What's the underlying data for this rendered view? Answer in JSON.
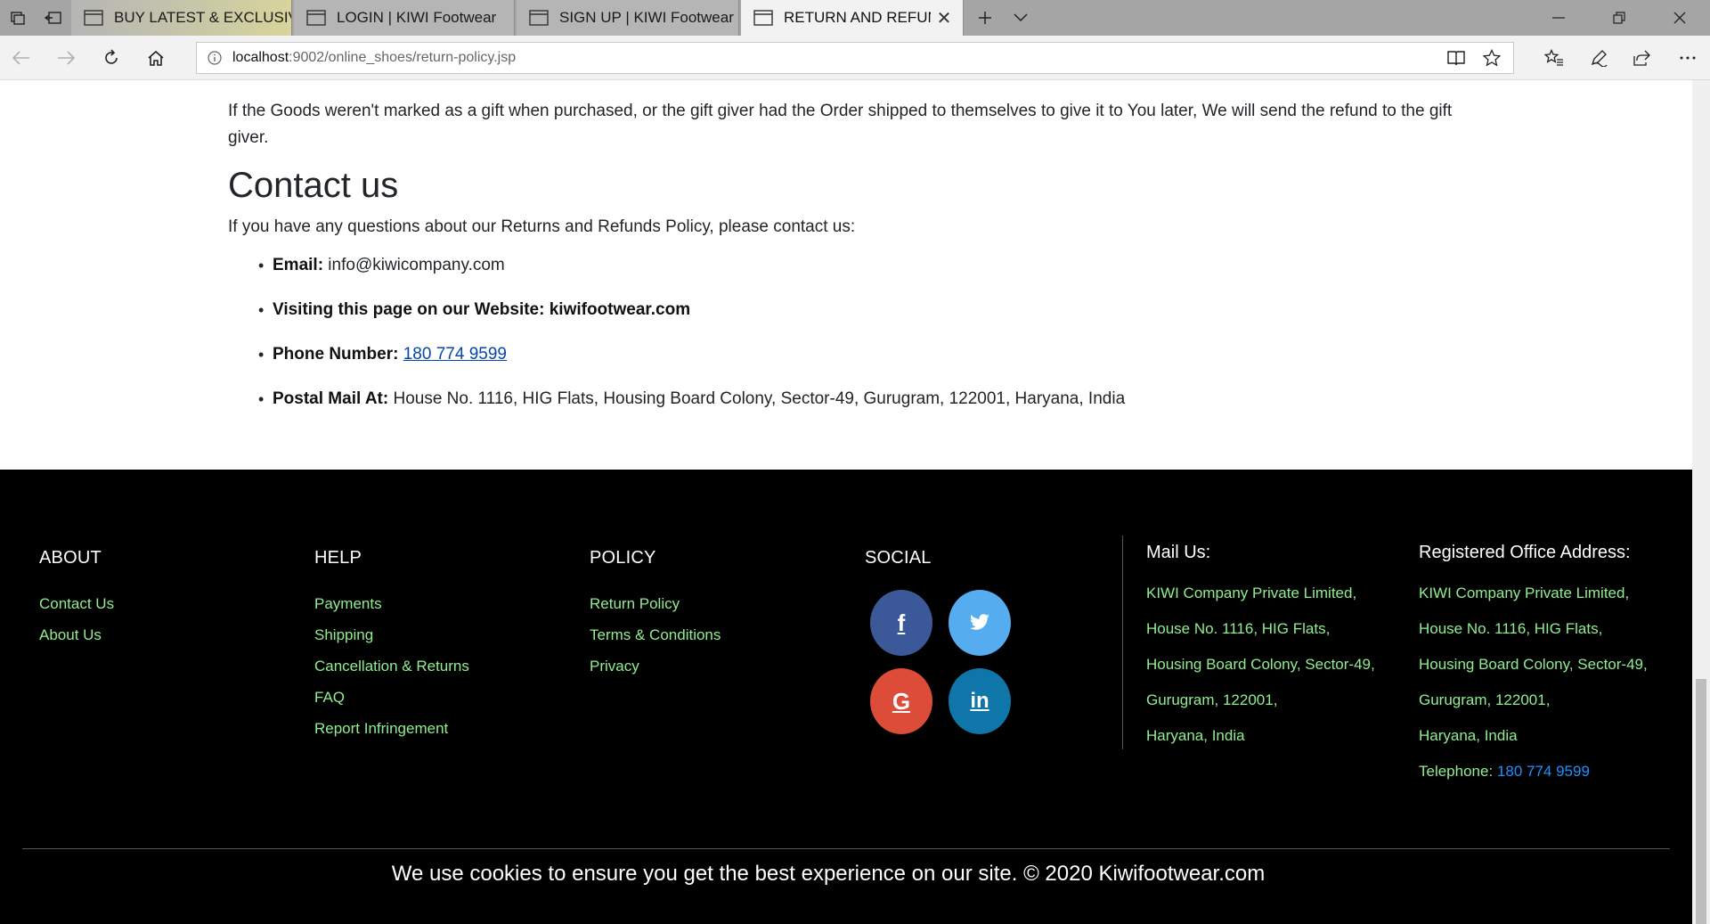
{
  "browser": {
    "tabs": [
      {
        "title": "BUY LATEST & EXCLUSIVE F",
        "active": false
      },
      {
        "title": "LOGIN | KIWI Footwear",
        "active": false
      },
      {
        "title": "SIGN UP | KIWI Footwear",
        "active": false
      },
      {
        "title": "RETURN AND REFUND",
        "active": true
      }
    ],
    "url_host": "localhost",
    "url_rest": ":9002/online_shoes/return-policy.jsp"
  },
  "content": {
    "gift_paragraph": "If the Goods weren't marked as a gift when purchased, or the gift giver had the Order shipped to themselves to give it to You later, We will send the refund to the gift giver.",
    "contact_heading": "Contact us",
    "contact_intro": "If you have any questions about our Returns and Refunds Policy, please contact us:",
    "email_label": "Email:",
    "email_value": " info@kiwicompany.com",
    "website_label": "Visiting this page on our Website: kiwifootwear.com",
    "phone_label": "Phone Number:",
    "phone_value": "180 774 9599",
    "postal_label": "Postal Mail At:",
    "postal_value": " House No. 1116, HIG Flats, Housing Board Colony, Sector-49, Gurugram, 122001, Haryana, India"
  },
  "footer": {
    "about": {
      "title": "ABOUT",
      "links": [
        "Contact Us",
        "About Us"
      ]
    },
    "help": {
      "title": "HELP",
      "links": [
        "Payments",
        "Shipping",
        "Cancellation & Returns",
        "FAQ",
        "Report Infringement"
      ]
    },
    "policy": {
      "title": "POLICY",
      "links": [
        "Return Policy",
        "Terms & Conditions",
        "Privacy"
      ]
    },
    "social": {
      "title": "SOCIAL",
      "items": [
        {
          "label": "f",
          "icon": "facebook-icon",
          "color": "#3b5998"
        },
        {
          "label": "t",
          "icon": "twitter-icon",
          "color": "#55acee"
        },
        {
          "label": "G",
          "icon": "google-icon",
          "color": "#dd4b39"
        },
        {
          "label": "in",
          "icon": "linkedin-icon",
          "color": "#0e76a8"
        }
      ]
    },
    "mail": {
      "title": "Mail Us:",
      "lines": [
        "KIWI Company Private Limited,",
        "House No. 1116, HIG Flats,",
        "Housing Board Colony, Sector-49,",
        "Gurugram, 122001,",
        "Haryana, India"
      ]
    },
    "office": {
      "title": "Registered Office Address:",
      "lines": [
        "KIWI Company Private Limited,",
        "House No. 1116, HIG Flats,",
        "Housing Board Colony, Sector-49,",
        "Gurugram, 122001,",
        "Haryana, India"
      ],
      "telephone_label": "Telephone: ",
      "telephone_value": "180 774 9599"
    },
    "copyright": "We use cookies to ensure you get the best experience on our site. © 2020 Kiwifootwear.com"
  },
  "colors": {
    "footer_link": "#90ee90",
    "footer_bg": "#000000",
    "phone_link": "#1e90ff"
  }
}
